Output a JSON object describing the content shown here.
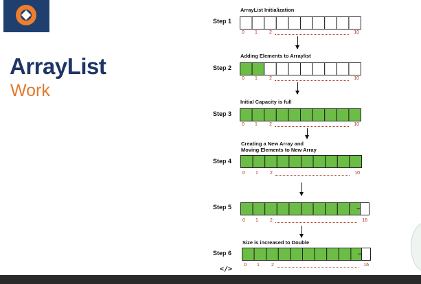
{
  "slide": {
    "title": "ArrayList",
    "subtitle": "Work",
    "code_icon": "</>"
  },
  "colors": {
    "title": "#1f3565",
    "subtitle": "#e07a2c",
    "filled_cell": "#6cbd45",
    "empty_cell": "#ffffff",
    "logo_bg": "#1f3f6e",
    "logo_accent": "#ee7d2d"
  },
  "icons": [
    "logo-icon",
    "code-icon",
    "down-arrow-icon"
  ],
  "steps": [
    {
      "label": "Step 1",
      "caption": "ArrayList Initialization",
      "filled": 0,
      "cells": 10,
      "gap": false,
      "indices": [
        "0",
        "1",
        "2",
        "10"
      ]
    },
    {
      "label": "Step 2",
      "caption": "Adding Elements to Arraylist",
      "filled": 2,
      "cells": 10,
      "gap": false,
      "indices": [
        "0",
        "1",
        "2",
        "10"
      ]
    },
    {
      "label": "Step 3",
      "caption": "Initial Capacity is full",
      "filled": 10,
      "cells": 10,
      "gap": false,
      "indices": [
        "0",
        "1",
        "2",
        "10"
      ]
    },
    {
      "label": "Step 4",
      "caption": "Creating a New Array and\nMoving Elements to New Array",
      "filled": 10,
      "cells": 10,
      "gap": false,
      "indices": [
        "0",
        "1",
        "2",
        "10"
      ]
    },
    {
      "label": "Step 5",
      "caption": "",
      "filled": 10,
      "cells": 10,
      "gap": true,
      "gap_text": "•••••••",
      "indices": [
        "0",
        "1",
        "2",
        "16"
      ]
    },
    {
      "label": "Step 6",
      "caption": "Size is increased to Double",
      "filled": 10,
      "cells": 10,
      "gap": true,
      "gap_text": "•••••••",
      "indices": [
        "0",
        "1",
        "2",
        "16"
      ]
    }
  ]
}
